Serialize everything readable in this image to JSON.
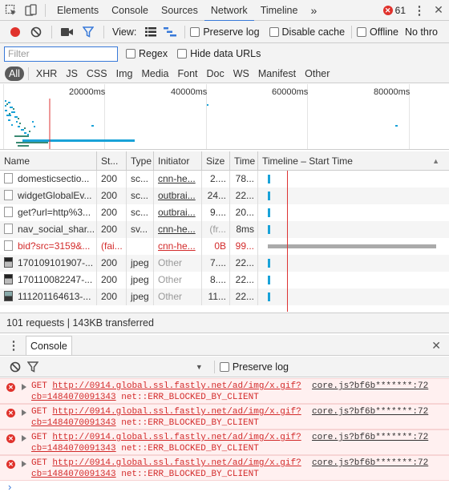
{
  "tabs": [
    "Elements",
    "Console",
    "Sources",
    "Network",
    "Timeline"
  ],
  "active_tab": "Network",
  "error_count": "61",
  "more_tabs_glyph": "»",
  "menu_glyph": "⋮",
  "close_glyph": "✕",
  "network_toolbar": {
    "view_label": "View:",
    "preserve_log": "Preserve log",
    "disable_cache": "Disable cache",
    "offline": "Offline",
    "throttle": "No thro"
  },
  "filter": {
    "placeholder": "Filter",
    "value": "",
    "regex": "Regex",
    "hide_data_urls": "Hide data URLs"
  },
  "type_filters": [
    "All",
    "XHR",
    "JS",
    "CSS",
    "Img",
    "Media",
    "Font",
    "Doc",
    "WS",
    "Manifest",
    "Other"
  ],
  "overview": {
    "ticks": [
      "20000ms",
      "40000ms",
      "60000ms",
      "80000ms"
    ]
  },
  "columns": [
    "Name",
    "St...",
    "Type",
    "Initiator",
    "Size",
    "Time",
    "Timeline – Start Time"
  ],
  "sort_glyph": "▲",
  "requests": [
    {
      "name": "domesticsectio...",
      "status": "200",
      "type": "sc...",
      "initiator": "cnn-he...",
      "size": "2....",
      "time": "78...",
      "icon": "doc",
      "error": false,
      "initiator_link": true,
      "size_gray": false
    },
    {
      "name": "widgetGlobalEv...",
      "status": "200",
      "type": "sc...",
      "initiator": "outbrai...",
      "size": "24...",
      "time": "22...",
      "icon": "doc",
      "error": false,
      "initiator_link": true,
      "size_gray": false
    },
    {
      "name": "get?url=http%3...",
      "status": "200",
      "type": "sc...",
      "initiator": "outbrai...",
      "size": "9....",
      "time": "20...",
      "icon": "doc",
      "error": false,
      "initiator_link": true,
      "size_gray": false
    },
    {
      "name": "nav_social_shar...",
      "status": "200",
      "type": "sv...",
      "initiator": "cnn-he...",
      "size": "(fr...",
      "time": "8ms",
      "icon": "doc",
      "error": false,
      "initiator_link": true,
      "size_gray": true
    },
    {
      "name": "bid?src=3159&...",
      "status": "(fai...",
      "type": "",
      "initiator": "cnn-he...",
      "size": "0B",
      "time": "99...",
      "icon": "doc",
      "error": true,
      "initiator_link": true,
      "size_gray": false
    },
    {
      "name": "170109101907-...",
      "status": "200",
      "type": "jpeg",
      "initiator": "Other",
      "size": "7....",
      "time": "22...",
      "icon": "img",
      "error": false,
      "initiator_link": false,
      "size_gray": false
    },
    {
      "name": "170110082247-...",
      "status": "200",
      "type": "jpeg",
      "initiator": "Other",
      "size": "8....",
      "time": "22...",
      "icon": "img",
      "error": false,
      "initiator_link": false,
      "size_gray": false
    },
    {
      "name": "111201164613-...",
      "status": "200",
      "type": "jpeg",
      "initiator": "Other",
      "size": "11...",
      "time": "22...",
      "icon": "img2",
      "error": false,
      "initiator_link": false,
      "size_gray": false
    }
  ],
  "status_bar": "101 requests | 143KB transferred",
  "drawer": {
    "tab": "Console",
    "preserve_log": "Preserve log"
  },
  "console_messages": [
    {
      "method": "GET",
      "url": "http://0914.global.ssl.fastly.net/ad/img/x.gif?",
      "cont": "cb=1484070091343",
      "error": "net::ERR_BLOCKED_BY_CLIENT",
      "source": "core.js?bf6b*******:72"
    },
    {
      "method": "GET",
      "url": "http://0914.global.ssl.fastly.net/ad/img/x.gif?",
      "cont": "cb=1484070091343",
      "error": "net::ERR_BLOCKED_BY_CLIENT",
      "source": "core.js?bf6b*******:72"
    },
    {
      "method": "GET",
      "url": "http://0914.global.ssl.fastly.net/ad/img/x.gif?",
      "cont": "cb=1484070091343",
      "error": "net::ERR_BLOCKED_BY_CLIENT",
      "source": "core.js?bf6b*******:72"
    },
    {
      "method": "GET",
      "url": "http://0914.global.ssl.fastly.net/ad/img/x.gif?",
      "cont": "cb=1484070091343",
      "error": "net::ERR_BLOCKED_BY_CLIENT",
      "source": "core.js?bf6b*******:72"
    }
  ],
  "console_prompt": "›",
  "colors": {
    "accent": "#3879d9",
    "error": "#d32b2b",
    "timeline_bar": "#19a2d8"
  }
}
